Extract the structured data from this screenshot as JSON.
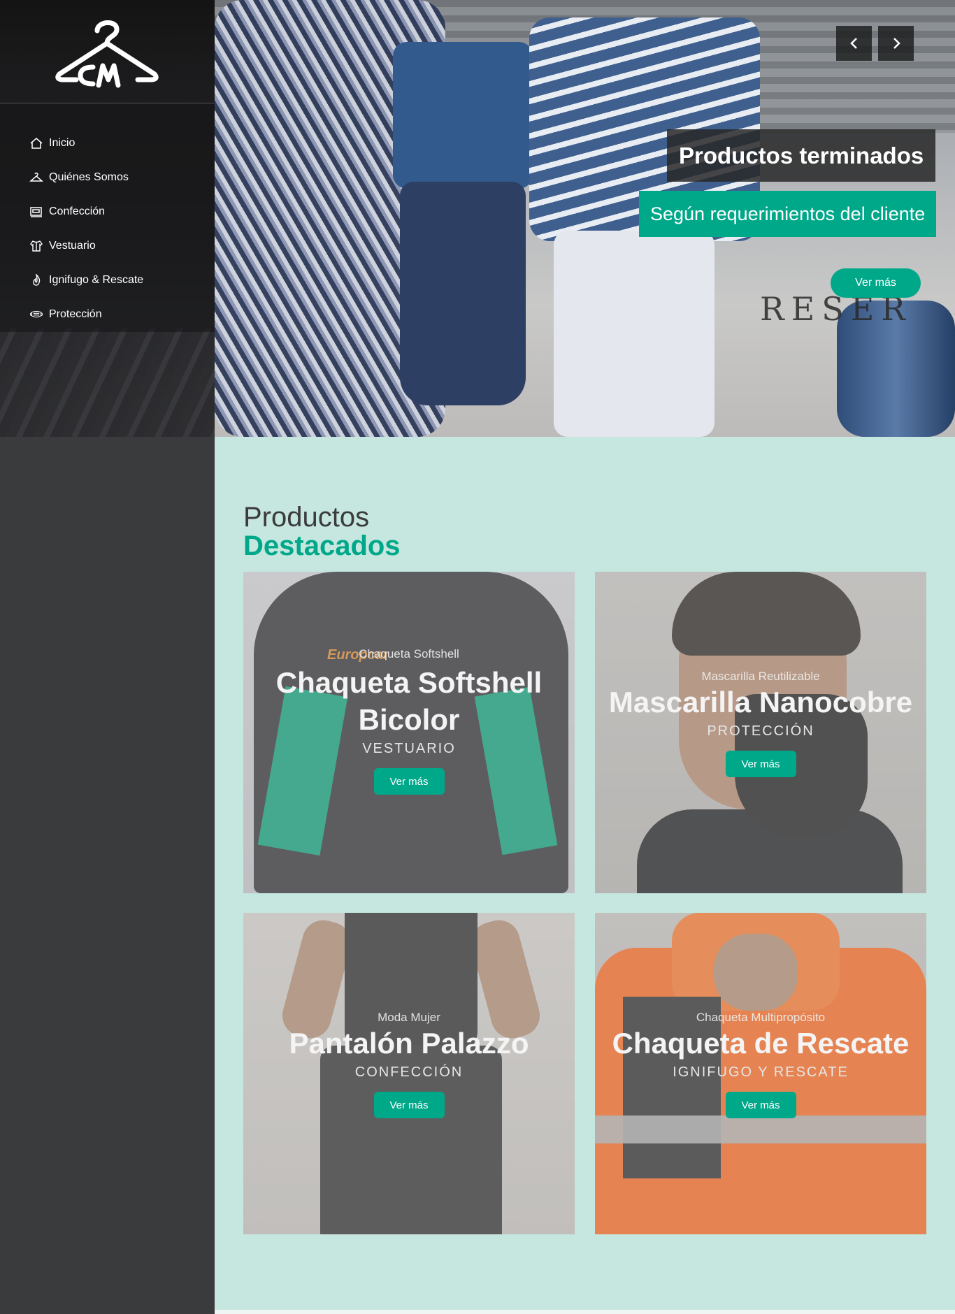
{
  "nav": {
    "items": [
      {
        "label": "Inicio",
        "icon": "home-icon"
      },
      {
        "label": "Quiénes Somos",
        "icon": "hanger-icon"
      },
      {
        "label": "Confección",
        "icon": "sewing-machine-icon"
      },
      {
        "label": "Vestuario",
        "icon": "shirt-icon"
      },
      {
        "label": "Ignifugo & Rescate",
        "icon": "flame-icon"
      },
      {
        "label": "Protección",
        "icon": "mask-icon"
      }
    ]
  },
  "hero": {
    "title": "Productos terminados",
    "subtitle": "Según requerimientos del cliente",
    "button": "Ver más",
    "backdrop_text": "RESER"
  },
  "featured": {
    "heading_line1": "Productos",
    "heading_line2": "Destacados",
    "cards": [
      {
        "subtitle": "Chaqueta Softshell",
        "title": "Chaqueta Softshell Bicolor",
        "category": "VESTUARIO",
        "button": "Ver más",
        "print": "Europcar"
      },
      {
        "subtitle": "Mascarilla Reutilizable",
        "title": "Mascarilla Nanocobre",
        "category": "PROTECCIÓN",
        "button": "Ver más"
      },
      {
        "subtitle": "Moda Mujer",
        "title": "Pantalón Palazzo",
        "category": "CONFECCIÓN",
        "button": "Ver más"
      },
      {
        "subtitle": "Chaqueta Multipropósito",
        "title": "Chaqueta de Rescate",
        "category": "IGNIFUGO Y RESCATE",
        "button": "Ver más"
      }
    ]
  },
  "colors": {
    "accent": "#00a88a",
    "page_bg": "#c5e7df",
    "sidebar_bg": "#3a3b3d"
  }
}
